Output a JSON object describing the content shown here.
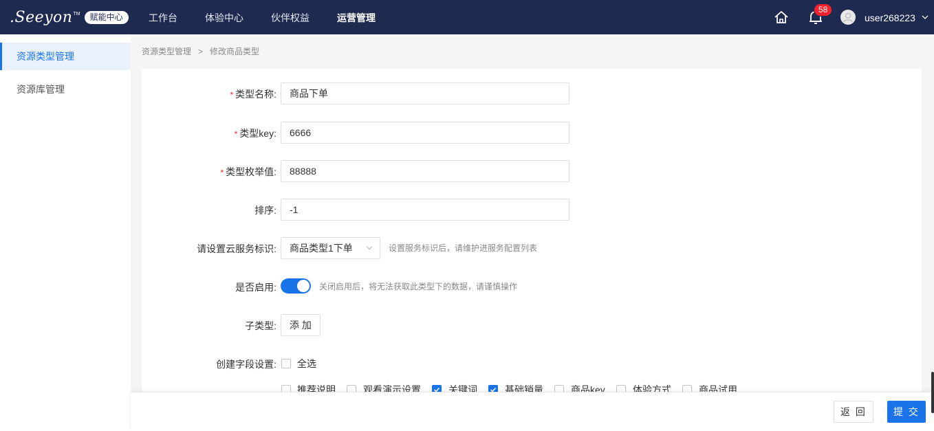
{
  "header": {
    "logo_text": ".Seeyon",
    "logo_tm": "TM",
    "badge": "赋能中心",
    "nav": [
      "工作台",
      "体验中心",
      "伙伴权益",
      "运营管理"
    ],
    "active_nav": "运营管理",
    "notification_count": "58",
    "username": "user268223",
    "bg_color": "#1e2a4f"
  },
  "sidebar": {
    "items": [
      {
        "label": "资源类型管理",
        "active": true
      },
      {
        "label": "资源库管理",
        "active": false
      }
    ]
  },
  "breadcrumb": {
    "parent": "资源类型管理",
    "separator": ">",
    "current": "修改商品类型"
  },
  "form": {
    "type_name": {
      "label": "类型名称",
      "value": "商品下单",
      "required": true
    },
    "type_key": {
      "label": "类型key",
      "value": "6666",
      "required": true
    },
    "type_enum": {
      "label": "类型枚举值",
      "value": "88888",
      "required": true
    },
    "sort": {
      "label": "排序",
      "value": "-1",
      "required": false
    },
    "cloud_service": {
      "label": "请设置云服务标识",
      "value": "商品类型1下单",
      "hint": "设置服务标识后，请维护进服务配置列表"
    },
    "enabled": {
      "label": "是否启用",
      "value": true,
      "hint": "关闭启用后，将无法获取此类型下的数据，请谨慎操作"
    },
    "subtype": {
      "label": "子类型",
      "button": "添 加"
    },
    "fields": {
      "label": "创建字段设置",
      "select_all": {
        "label": "全选",
        "checked": false
      },
      "options": [
        {
          "label": "推荐说明",
          "checked": false
        },
        {
          "label": "观看演示设置",
          "checked": false
        },
        {
          "label": "关键词",
          "checked": true
        },
        {
          "label": "基础销量",
          "checked": true
        },
        {
          "label": "商品key",
          "checked": false
        },
        {
          "label": "体验方式",
          "checked": false
        },
        {
          "label": "商品试用",
          "checked": false
        }
      ]
    },
    "colon": ":"
  },
  "footer": {
    "back": "返 回",
    "submit": "提 交"
  },
  "colors": {
    "primary": "#1a73e8",
    "required": "#f5222d"
  }
}
